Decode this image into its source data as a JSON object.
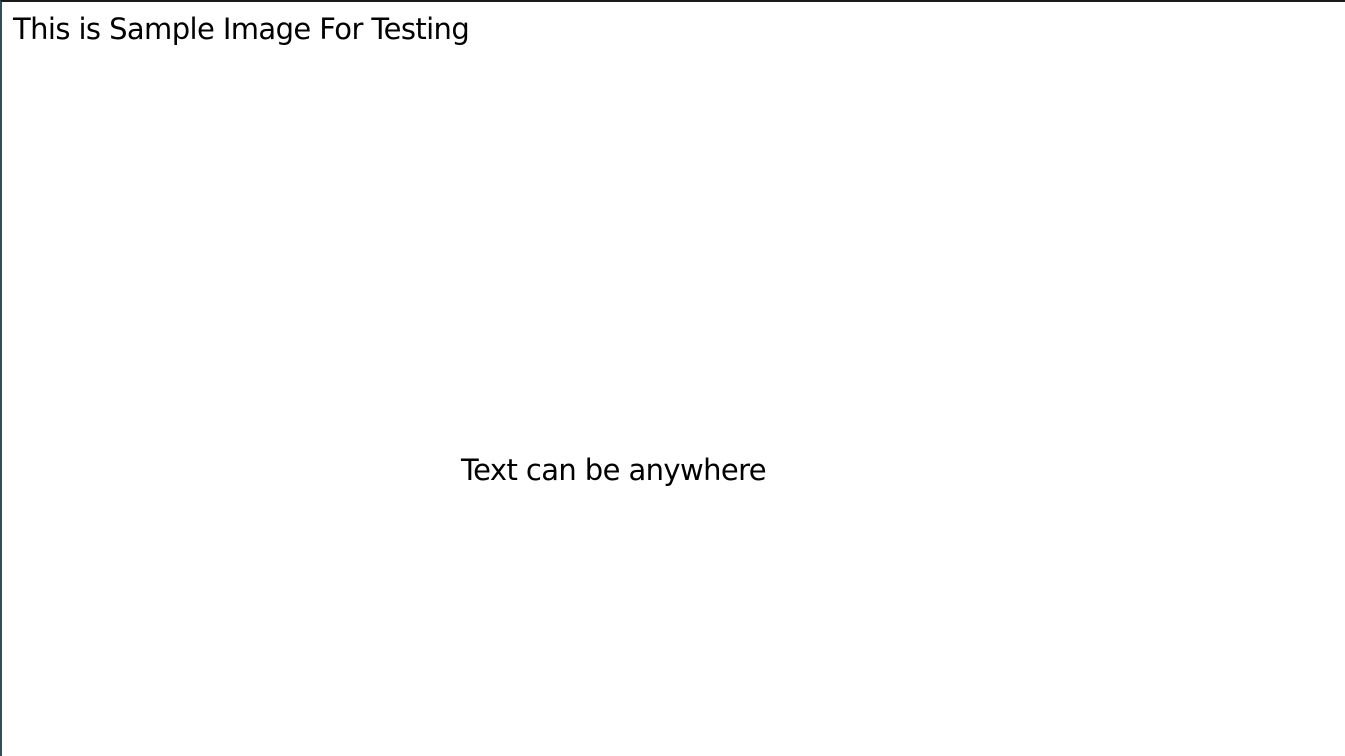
{
  "heading": "This is Sample Image For Testing",
  "body_text": "Text can be anywhere"
}
